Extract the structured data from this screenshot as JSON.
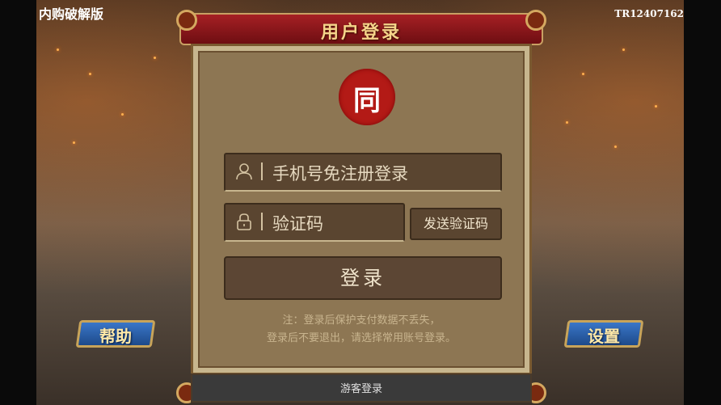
{
  "top_left_label": "内购破解版",
  "top_right_label": "TR12407162",
  "dialog": {
    "title": "用户登录",
    "logo_text": "同",
    "phone_placeholder": "手机号免注册登录",
    "code_placeholder": "验证码",
    "send_code_label": "发送验证码",
    "login_label": "登录",
    "note_line1": "注：登录后保护支付数据不丢失，",
    "note_line2": "登录后不要退出，请选择常用账号登录。",
    "guest_login_label": "游客登录"
  },
  "left_button_label": "帮助",
  "right_button_label": "设置",
  "icons": {
    "user": "user-icon",
    "lock": "lock-icon"
  },
  "colors": {
    "title_bar": "#a62024",
    "panel": "#8d7653",
    "input": "#5a4530",
    "side_button": "#3a76c8",
    "gold": "#c8a45a"
  }
}
